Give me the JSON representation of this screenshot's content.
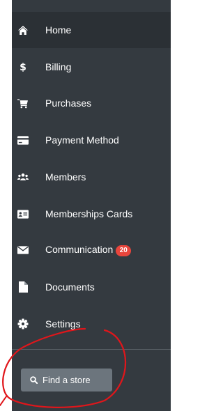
{
  "sidebar": {
    "items": [
      {
        "label": "Home",
        "icon": "home-icon"
      },
      {
        "label": "Billing",
        "icon": "dollar-icon"
      },
      {
        "label": "Purchases",
        "icon": "cart-icon"
      },
      {
        "label": "Payment Method",
        "icon": "credit-card-icon"
      },
      {
        "label": "Members",
        "icon": "users-icon"
      },
      {
        "label": "Memberships Cards",
        "icon": "id-card-icon"
      },
      {
        "label": "Communication",
        "icon": "envelope-icon",
        "badge": "20"
      },
      {
        "label": "Documents",
        "icon": "file-icon"
      },
      {
        "label": "Settings",
        "icon": "gear-icon"
      }
    ],
    "find_store_label": "Find a store"
  },
  "colors": {
    "sidebar_bg": "#343a40",
    "active_bg": "#2b3035",
    "badge_bg": "#e8453c",
    "button_bg": "#6c757d",
    "annotation": "#e0161b"
  }
}
